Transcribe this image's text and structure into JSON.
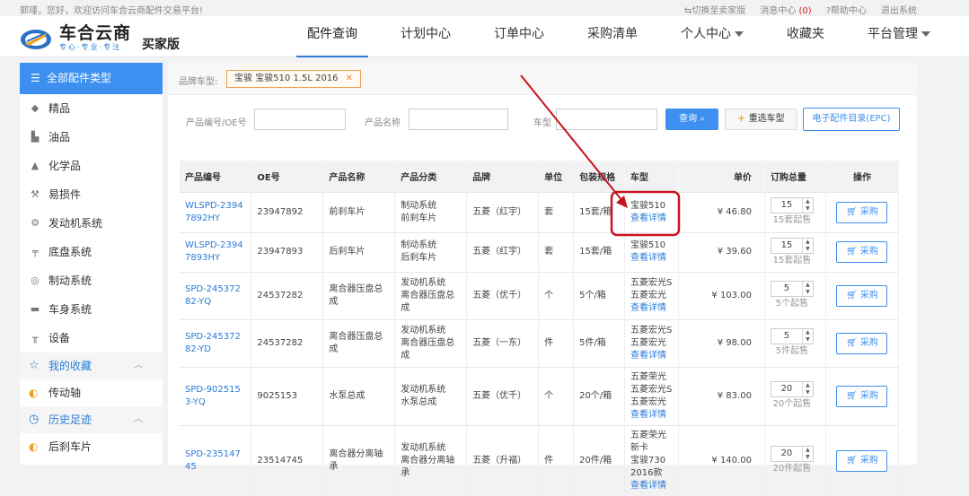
{
  "topbar": {
    "welcome": "郭瑾，您好，欢迎访问车合云商配件交易平台!",
    "switch_label": "⇆切换至卖家版",
    "messages_label": "消息中心",
    "messages_count": "(0)",
    "help_label": "帮助中心",
    "logout_label": "退出系统"
  },
  "logo": {
    "name": "车合云商",
    "slogan": "专心·专业·专注",
    "edition": "买家版"
  },
  "nav": {
    "items": [
      "配件查询",
      "计划中心",
      "订单中心",
      "采购清单",
      "个人中心",
      "收藏夹",
      "平台管理"
    ]
  },
  "sidebar": {
    "all_label": "全部配件类型",
    "categories": [
      "精品",
      "油品",
      "化学品",
      "易损件",
      "发动机系统",
      "底盘系统",
      "制动系统",
      "车身系统",
      "设备"
    ],
    "favorites_label": "我的收藏",
    "favorite_items": [
      "传动轴"
    ],
    "history_label": "历史足迹",
    "history_items": [
      "后刹车片"
    ]
  },
  "filter": {
    "brand_label": "品牌车型:",
    "brand_tag": "宝骏 宝骏510 1.5L 2016",
    "product_code_label": "产品编号/OE号",
    "product_name_label": "产品名称",
    "vehicle_label": "车型",
    "search_button": "查询",
    "reset_button": "重选车型",
    "epc_button": "电子配件目录(EPC)"
  },
  "table": {
    "headers": [
      "产品编号",
      "OE号",
      "产品名称",
      "产品分类",
      "品牌",
      "单位",
      "包装规格",
      "车型",
      "单价",
      "订购总量",
      "操作"
    ],
    "rows": [
      {
        "pid": "WLSPD-23947892HY",
        "oe": "23947892",
        "name": "前刹车片",
        "cat1": "制动系统",
        "cat2": "前刹车片",
        "brand": "五菱（红宇）",
        "unit": "套",
        "pack": "15套/箱",
        "models": [
          "宝骏510"
        ],
        "detail": "查看详情",
        "price": "¥ 46.80",
        "qty": "15",
        "minq": "15套起售",
        "buy": "采购"
      },
      {
        "pid": "WLSPD-23947893HY",
        "oe": "23947893",
        "name": "后刹车片",
        "cat1": "制动系统",
        "cat2": "后刹车片",
        "brand": "五菱（红宇）",
        "unit": "套",
        "pack": "15套/箱",
        "models": [
          "宝骏510"
        ],
        "detail": "查看详情",
        "price": "¥ 39.60",
        "qty": "15",
        "minq": "15套起售",
        "buy": "采购"
      },
      {
        "pid": "SPD-24537282-YQ",
        "oe": "24537282",
        "name": "离合器压盘总成",
        "cat1": "发动机系统",
        "cat2": "离合器压盘总成",
        "brand": "五菱（优千）",
        "unit": "个",
        "pack": "5个/箱",
        "models": [
          "五菱宏光S",
          "五菱宏光"
        ],
        "detail": "查看详情",
        "price": "¥ 103.00",
        "qty": "5",
        "minq": "5个起售",
        "buy": "采购"
      },
      {
        "pid": "SPD-24537282-YD",
        "oe": "24537282",
        "name": "离合器压盘总成",
        "cat1": "发动机系统",
        "cat2": "离合器压盘总成",
        "brand": "五菱（一东）",
        "unit": "件",
        "pack": "5件/箱",
        "models": [
          "五菱宏光S",
          "五菱宏光"
        ],
        "detail": "查看详情",
        "price": "¥ 98.00",
        "qty": "5",
        "minq": "5件起售",
        "buy": "采购"
      },
      {
        "pid": "SPD-9025153-YQ",
        "oe": "9025153",
        "name": "水泵总成",
        "cat1": "发动机系统",
        "cat2": "水泵总成",
        "brand": "五菱（优千）",
        "unit": "个",
        "pack": "20个/箱",
        "models": [
          "五菱荣光",
          "五菱宏光S",
          "五菱宏光"
        ],
        "detail": "查看详情",
        "price": "¥ 83.00",
        "qty": "20",
        "minq": "20个起售",
        "buy": "采购"
      },
      {
        "pid": "SPD-23514745",
        "oe": "23514745",
        "name": "离合器分离轴承",
        "cat1": "发动机系统",
        "cat2": "离合器分离轴承",
        "brand": "五菱（升福）",
        "unit": "件",
        "pack": "20件/箱",
        "models": [
          "五菱荣光新卡",
          "宝骏730 2016款"
        ],
        "detail": "查看详情",
        "price": "¥ 140.00",
        "qty": "20",
        "minq": "20件起售",
        "buy": "采购"
      }
    ]
  },
  "colors": {
    "accent": "#3d8ff0",
    "link": "#2a7bd6",
    "annotation": "#c8141e",
    "tag_border": "#f0a050"
  }
}
